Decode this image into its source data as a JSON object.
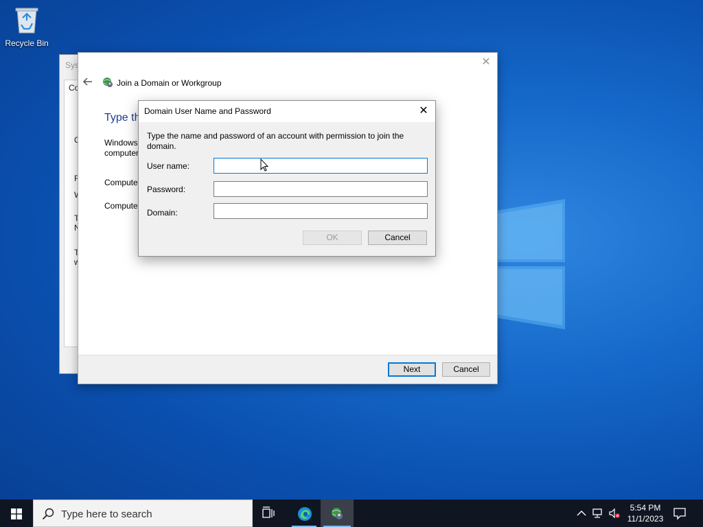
{
  "desktop": {
    "recycle_bin_label": "Recycle Bin"
  },
  "system_window": {
    "title_fragment": "Syst",
    "tab_fragment": "Co",
    "fragments": [
      "C",
      "F",
      "W",
      "T",
      "N",
      "T",
      "w"
    ]
  },
  "wizard": {
    "title": "Join a Domain or Workgroup",
    "heading_fragment": "Type th",
    "text_lines": [
      "Windows",
      "computer",
      "Compute",
      "Compute"
    ],
    "next_label": "Next",
    "cancel_label": "Cancel",
    "close_glyph": "✕"
  },
  "dialog": {
    "title": "Domain User Name and Password",
    "description": "Type the name and password of an account with permission to join the domain.",
    "username_label": "User name:",
    "username_value": "",
    "password_label": "Password:",
    "password_value": "",
    "domain_label": "Domain:",
    "domain_value": "",
    "ok_label": "OK",
    "cancel_label": "Cancel",
    "close_glyph": "✕"
  },
  "taskbar": {
    "search_placeholder": "Type here to search",
    "time": "5:54 PM",
    "date": "11/1/2023"
  },
  "colors": {
    "accent": "#0078d7",
    "heading_blue": "#1c3e8c",
    "taskbar": "#101522"
  }
}
